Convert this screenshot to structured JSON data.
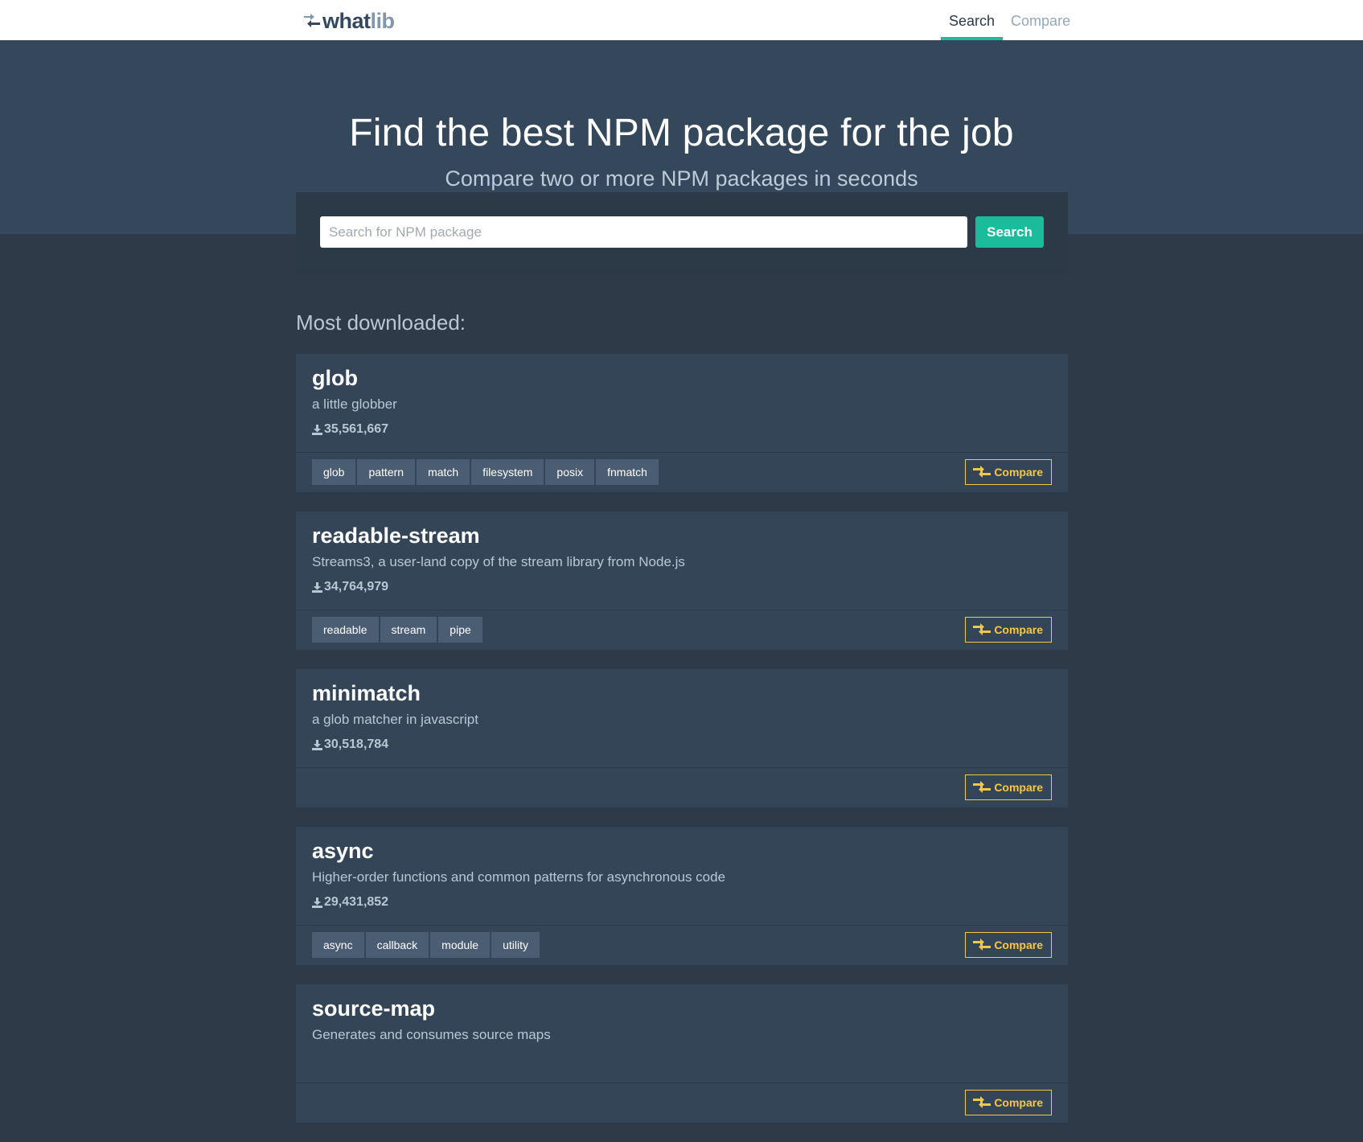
{
  "brand": {
    "what": "what",
    "lib": "lib"
  },
  "nav": {
    "search": "Search",
    "compare": "Compare"
  },
  "hero": {
    "title": "Find the best NPM package for the job",
    "subtitle": "Compare two or more NPM packages in seconds"
  },
  "search": {
    "placeholder": "Search for NPM package",
    "button": "Search"
  },
  "list_title": "Most downloaded:",
  "compare_label": "Compare",
  "packages": [
    {
      "name": "glob",
      "description": "a little globber",
      "downloads": "35,561,667",
      "tags": [
        "glob",
        "pattern",
        "match",
        "filesystem",
        "posix",
        "fnmatch"
      ]
    },
    {
      "name": "readable-stream",
      "description": "Streams3, a user-land copy of the stream library from Node.js",
      "downloads": "34,764,979",
      "tags": [
        "readable",
        "stream",
        "pipe"
      ]
    },
    {
      "name": "minimatch",
      "description": "a glob matcher in javascript",
      "downloads": "30,518,784",
      "tags": []
    },
    {
      "name": "async",
      "description": "Higher-order functions and common patterns for asynchronous code",
      "downloads": "29,431,852",
      "tags": [
        "async",
        "callback",
        "module",
        "utility"
      ]
    },
    {
      "name": "source-map",
      "description": "Generates and consumes source maps",
      "downloads": "",
      "tags": []
    }
  ],
  "colors": {
    "accent": "#1abc9c",
    "compare": "#f5c842",
    "background": "#2e3a48",
    "card": "#354558"
  },
  "icons": {
    "logo": "whatlib-arrows-icon",
    "download": "download-icon",
    "compare": "compare-arrows-icon"
  }
}
